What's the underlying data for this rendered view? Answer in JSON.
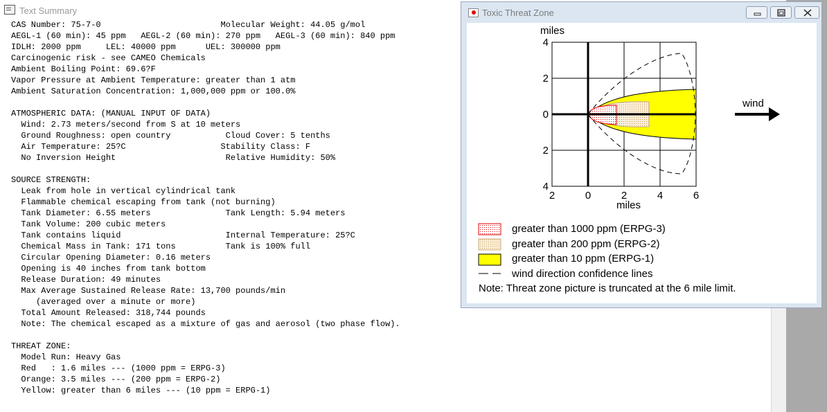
{
  "text_summary": {
    "title": "Text Summary",
    "lines": [
      "CAS Number: 75-7-0                        Molecular Weight: 44.05 g/mol",
      "AEGL-1 (60 min): 45 ppm   AEGL-2 (60 min): 270 ppm   AEGL-3 (60 min): 840 ppm",
      "IDLH: 2000 ppm     LEL: 40000 ppm      UEL: 300000 ppm",
      "Carcinogenic risk - see CAMEO Chemicals",
      "Ambient Boiling Point: 69.6?F",
      "Vapor Pressure at Ambient Temperature: greater than 1 atm",
      "Ambient Saturation Concentration: 1,000,000 ppm or 100.0%",
      "",
      "ATMOSPHERIC DATA: (MANUAL INPUT OF DATA)",
      "  Wind: 2.73 meters/second from S at 10 meters",
      "  Ground Roughness: open country           Cloud Cover: 5 tenths",
      "  Air Temperature: 25?C                   Stability Class: F",
      "  No Inversion Height                      Relative Humidity: 50%",
      "",
      "SOURCE STRENGTH:",
      "  Leak from hole in vertical cylindrical tank",
      "  Flammable chemical escaping from tank (not burning)",
      "  Tank Diameter: 6.55 meters               Tank Length: 5.94 meters",
      "  Tank Volume: 200 cubic meters",
      "  Tank contains liquid                     Internal Temperature: 25?C",
      "  Chemical Mass in Tank: 171 tons          Tank is 100% full",
      "  Circular Opening Diameter: 0.16 meters",
      "  Opening is 40 inches from tank bottom",
      "  Release Duration: 49 minutes",
      "  Max Average Sustained Release Rate: 13,700 pounds/min",
      "     (averaged over a minute or more)",
      "  Total Amount Released: 318,744 pounds",
      "  Note: The chemical escaped as a mixture of gas and aerosol (two phase flow).",
      "",
      "THREAT ZONE:",
      "  Model Run: Heavy Gas",
      "  Red   : 1.6 miles --- (1000 ppm = ERPG-3)",
      "  Orange: 3.5 miles --- (200 ppm = ERPG-2)",
      "  Yellow: greater than 6 miles --- (10 ppm = ERPG-1)"
    ]
  },
  "threat_zone_window": {
    "title": "Toxic Threat Zone",
    "window_buttons": [
      "minimize",
      "maximize",
      "close"
    ],
    "plot": {
      "y_unit_label": "miles",
      "x_unit_label": "miles",
      "y_tick_labels": [
        "4",
        "2",
        "0",
        "2",
        "4"
      ],
      "x_tick_labels": [
        "2",
        "0",
        "2",
        "4",
        "6"
      ],
      "x_range_miles": [
        -2,
        6
      ],
      "y_range_miles": [
        -4,
        4
      ],
      "wind_label": "wind",
      "zones": [
        {
          "name": "red",
          "reach_miles": 1.6,
          "color": "#e00000"
        },
        {
          "name": "orange",
          "reach_miles": 3.5,
          "color": "#e8c890"
        },
        {
          "name": "yellow",
          "reach_miles": 6,
          "color": "#ffff00"
        }
      ]
    },
    "legend": [
      {
        "key": "red",
        "text": "greater than 1000 ppm (ERPG-3)"
      },
      {
        "key": "orange",
        "text": "greater than 200 ppm (ERPG-2)"
      },
      {
        "key": "yellow",
        "text": "greater than 10 ppm (ERPG-1)"
      },
      {
        "key": "dash",
        "text": "wind direction confidence lines"
      }
    ],
    "note": "Note: Threat zone picture is truncated at the 6 mile limit."
  }
}
